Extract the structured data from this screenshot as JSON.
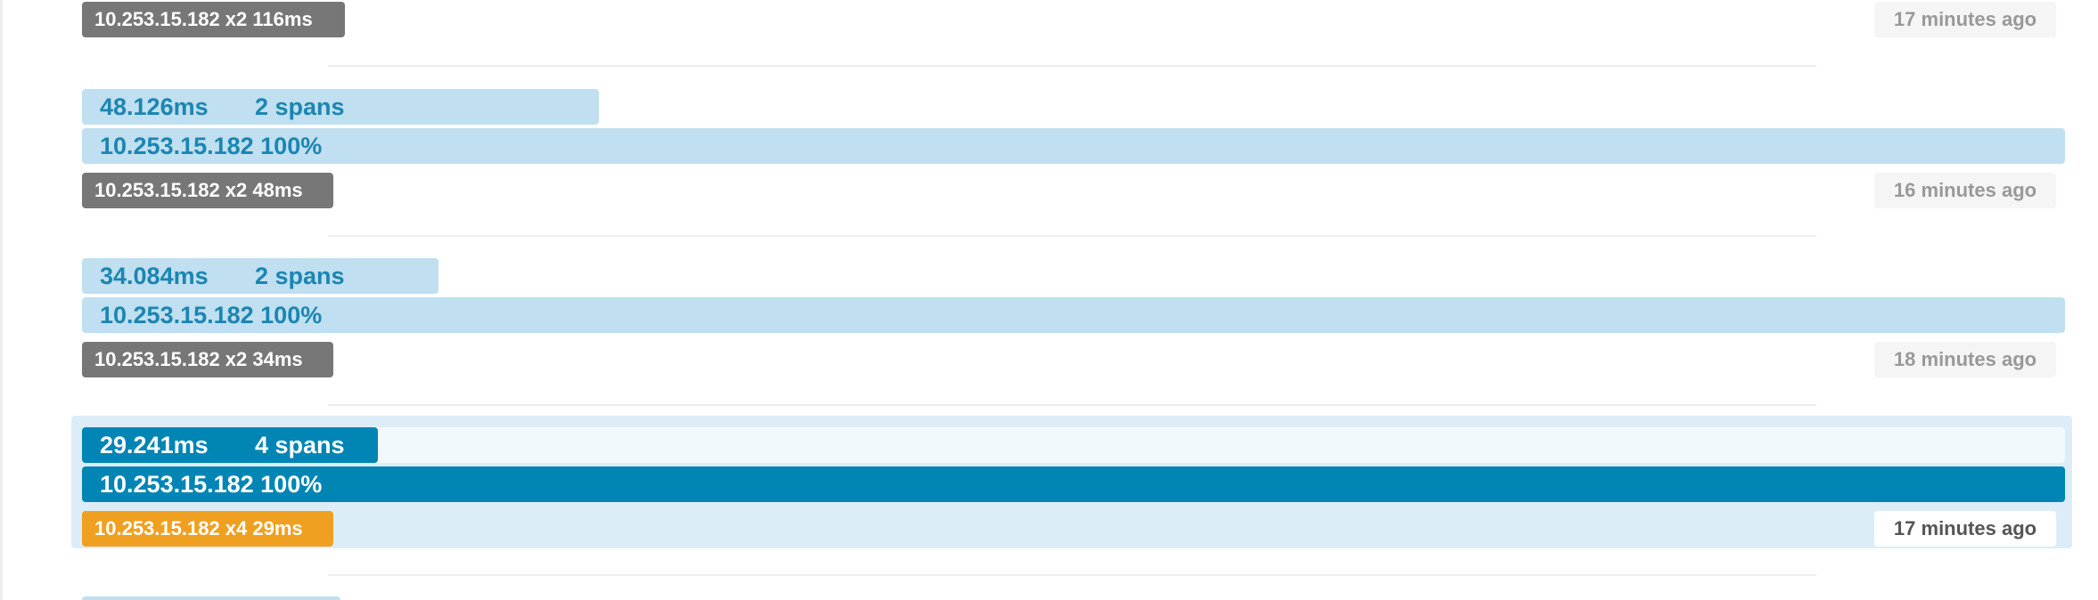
{
  "traces": [
    {
      "badge": "10.253.15.182 x2 116ms",
      "time": "17 minutes ago"
    },
    {
      "duration": "48.126ms",
      "spans": "2 spans",
      "service": "10.253.15.182 100%",
      "badge": "10.253.15.182 x2 48ms",
      "time": "16 minutes ago"
    },
    {
      "duration": "34.084ms",
      "spans": "2 spans",
      "service": "10.253.15.182 100%",
      "badge": "10.253.15.182 x2 34ms",
      "time": "18 minutes ago"
    },
    {
      "duration": "29.241ms",
      "spans": "4 spans",
      "service": "10.253.15.182 100%",
      "badge": "10.253.15.182 x4 29ms",
      "time": "17 minutes ago",
      "selected": true
    }
  ],
  "colors": {
    "bar_light": "#c0dff0",
    "bar_selected": "#0085b5",
    "text_blue": "#1a86b2",
    "badge_gray": "#777777",
    "badge_orange": "#f0a020"
  }
}
